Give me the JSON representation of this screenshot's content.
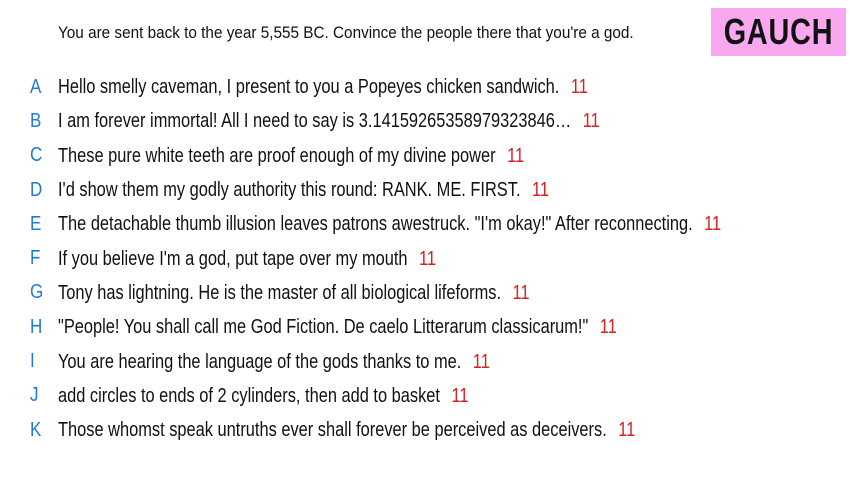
{
  "prompt": "You are sent back to the year 5,555 BC. Convince the people there that you're a god.",
  "player_name": "GAUCH",
  "colors": {
    "letter": "#1e7ad8",
    "score": "#d92020",
    "badge_bg": "#f9a7ee",
    "text": "#111111"
  },
  "answers": [
    {
      "letter": "A",
      "text": "Hello smelly caveman, I present to you a Popeyes chicken sandwich.",
      "score": "11"
    },
    {
      "letter": "B",
      "text": "I am forever immortal! All I need to say is 3.14159265358979323846…",
      "score": "11"
    },
    {
      "letter": "C",
      "text": "These pure white teeth are proof enough of my divine power",
      "score": "11"
    },
    {
      "letter": "D",
      "text": "I'd show them my godly authority this round: RANK. ME. FIRST.",
      "score": "11"
    },
    {
      "letter": "E",
      "text": "The detachable thumb illusion leaves patrons awestruck. \"I'm okay!\" After reconnecting.",
      "score": "11"
    },
    {
      "letter": "F",
      "text": "If you believe I'm a god, put tape over my mouth",
      "score": "11"
    },
    {
      "letter": "G",
      "text": "Tony has lightning. He is the master of all biological lifeforms.",
      "score": "11"
    },
    {
      "letter": "H",
      "text": "\"People! You shall call me God Fiction. De caelo Litterarum classicarum!\"",
      "score": "11"
    },
    {
      "letter": "I",
      "text": "You are hearing the language of the gods thanks to me.",
      "score": "11"
    },
    {
      "letter": "J",
      "text": "add circles to ends of 2 cylinders, then add to basket",
      "score": "11"
    },
    {
      "letter": "K",
      "text": "Those whomst speak untruths ever shall forever be perceived as deceivers.",
      "score": "11"
    }
  ]
}
